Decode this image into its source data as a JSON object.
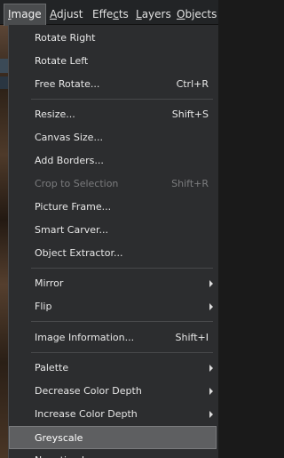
{
  "menubar": {
    "items": [
      {
        "label": "Image",
        "u": "I",
        "rest": "mage"
      },
      {
        "label": "Adjust",
        "u": "A",
        "rest": "djust"
      },
      {
        "label": "Effects",
        "pre": "Effe",
        "u": "c",
        "post": "ts"
      },
      {
        "label": "Layers",
        "u": "L",
        "rest": "ayers"
      },
      {
        "label": "Objects",
        "u": "O",
        "rest": "bjects"
      }
    ]
  },
  "image_menu": {
    "items": [
      {
        "label": "Rotate Right"
      },
      {
        "label": "Rotate Left"
      },
      {
        "label": "Free Rotate...",
        "shortcut": "Ctrl+R"
      },
      {
        "label": "Resize...",
        "shortcut": "Shift+S"
      },
      {
        "label": "Canvas Size..."
      },
      {
        "label": "Add Borders..."
      },
      {
        "label": "Crop to Selection",
        "shortcut": "Shift+R",
        "disabled": true
      },
      {
        "label": "Picture Frame..."
      },
      {
        "label": "Smart Carver..."
      },
      {
        "label": "Object Extractor..."
      },
      {
        "label": "Mirror",
        "submenu": true
      },
      {
        "label": "Flip",
        "submenu": true
      },
      {
        "label": "Image Information...",
        "shortcut": "Shift+I"
      },
      {
        "label": "Palette",
        "submenu": true
      },
      {
        "label": "Decrease Color Depth",
        "submenu": true
      },
      {
        "label": "Increase Color Depth",
        "submenu": true
      },
      {
        "label": "Greyscale",
        "highlighted": true
      },
      {
        "label": "Negative Image"
      }
    ]
  },
  "colors": {
    "menu_bg": "#2c2d2f",
    "highlight_bg": "#5e5f61",
    "text": "#e8e8e8",
    "disabled_text": "#7b7c7e"
  }
}
